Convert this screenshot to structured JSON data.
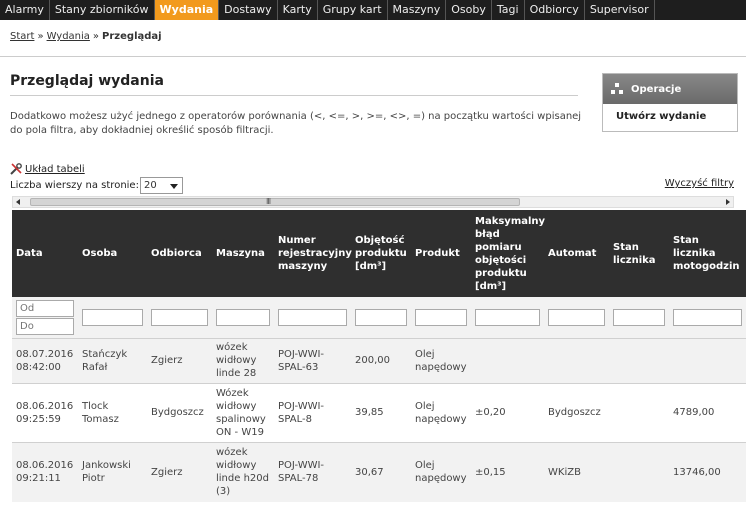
{
  "nav": {
    "items": [
      "Alarmy",
      "Stany zbiorników",
      "Wydania",
      "Dostawy",
      "Karty",
      "Grupy kart",
      "Maszyny",
      "Osoby",
      "Tagi",
      "Odbiorcy",
      "Supervisor"
    ],
    "active": "Wydania"
  },
  "breadcrumb": {
    "start": "Start",
    "section": "Wydania",
    "current": "Przeglądaj",
    "sep": "»"
  },
  "page": {
    "title": "Przeglądaj wydania",
    "hint": "Dodatkowo możesz użyć jednego z operatorów porównania (<, <=, >, >=, <>, =) na początku wartości wpisanej do pola filtra, aby dokładniej określić sposób filtracji."
  },
  "operations": {
    "title": "Operacje",
    "create": "Utwórz wydanie"
  },
  "table_tools": {
    "layout_label": "Układ tabeli",
    "rows_label": "Liczba wierszy na stronie:",
    "rows_value": "20",
    "clear_filters": "Wyczyść filtry"
  },
  "columns": [
    "Data",
    "Osoba",
    "Odbiorca",
    "Maszyna",
    "Numer rejestracyjny maszyny",
    "Objętość produktu [dm³]",
    "Produkt",
    "Maksymalny błąd pomiaru objętości produktu [dm³]",
    "Automat",
    "Stan licznika",
    "Stan licznika motogodzin"
  ],
  "filters": {
    "date_from_placeholder": "Od",
    "date_to_placeholder": "Do"
  },
  "rows": [
    {
      "date": "08.07.2016 08:42:00",
      "person": "Stańczyk Rafał",
      "recipient": "Zgierz",
      "machine": "wózek widłowy linde 28",
      "reg": "POJ-WWI-SPAL-63",
      "volume": "200,00",
      "product": "Olej napędowy",
      "error": "",
      "automat": "",
      "counter": "",
      "motohours": ""
    },
    {
      "date": "08.06.2016 09:25:59",
      "person": "Tlock Tomasz",
      "recipient": "Bydgoszcz",
      "machine": "Wózek widłowy spalinowy ON - W19",
      "reg": "POJ-WWI-SPAL-8",
      "volume": "39,85",
      "product": "Olej napędowy",
      "error": "±0,20",
      "automat": "Bydgoszcz",
      "counter": "",
      "motohours": "4789,00"
    },
    {
      "date": "08.06.2016 09:21:11",
      "person": "Jankowski Piotr",
      "recipient": "Zgierz",
      "machine": "wózek widłowy linde h20d (3)",
      "reg": "POJ-WWI-SPAL-78",
      "volume": "30,67",
      "product": "Olej napędowy",
      "error": "±0,15",
      "automat": "WKiZB",
      "counter": "",
      "motohours": "13746,00"
    }
  ]
}
